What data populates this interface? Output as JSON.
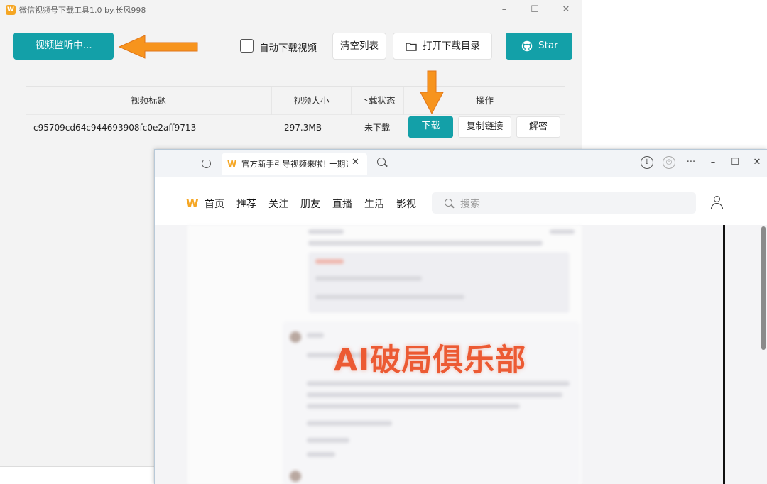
{
  "app": {
    "title": "微信视频号下载工具1.0 by.长风998",
    "logo_letter": "W",
    "window_controls": {
      "minimize": "–",
      "maximize": "☐",
      "close": "✕"
    },
    "toolbar": {
      "monitor_button": "视频监听中...",
      "auto_download_label": "自动下载视频",
      "auto_download_checked": false,
      "clear_button": "清空列表",
      "open_dir_button": "打开下载目录",
      "star_button": "Star"
    },
    "table": {
      "headers": [
        "视频标题",
        "视频大小",
        "下载状态",
        "操作"
      ],
      "rows": [
        {
          "title": "c95709cd64c944693908fc0e2aff9713",
          "size": "297.3MB",
          "status": "未下载",
          "actions": [
            "下载",
            "复制链接",
            "解密"
          ]
        }
      ]
    }
  },
  "browser": {
    "tab_title": "官方新手引导视频来啦! 一期讲",
    "tab_close": "✕",
    "controls": {
      "more": "···",
      "minimize": "–",
      "maximize": "☐",
      "close": "✕"
    },
    "nav": {
      "items": [
        "首页",
        "推荐",
        "关注",
        "朋友",
        "直播",
        "生活",
        "影视"
      ],
      "search_placeholder": "搜索"
    },
    "overlay_text": "AI破局俱乐部"
  },
  "colors": {
    "accent_teal": "#13a0a8",
    "annotation_orange": "#f7941d",
    "brand_orange": "#f5a623"
  },
  "icons": {
    "open_dir": "folder-icon",
    "star": "github-icon",
    "reload": "reload-icon",
    "search": "search-icon",
    "download": "download-icon",
    "user": "user-icon"
  }
}
